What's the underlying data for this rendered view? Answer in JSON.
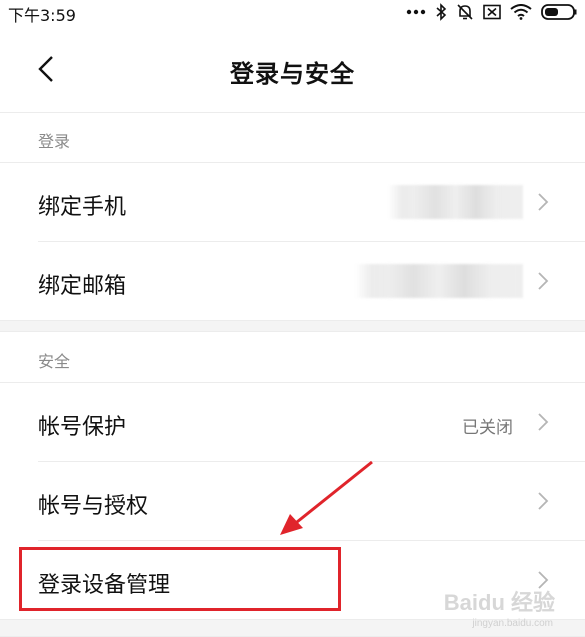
{
  "status_bar": {
    "time": "下午3:59",
    "icons": [
      "more-dots-icon",
      "bluetooth-icon",
      "mute-icon",
      "sim-off-icon",
      "wifi-icon",
      "battery-icon"
    ]
  },
  "header": {
    "title": "登录与安全",
    "back_icon": "back-arrow-icon"
  },
  "sections": [
    {
      "label": "登录",
      "items": [
        {
          "label": "绑定手机",
          "value_hidden": true
        },
        {
          "label": "绑定邮箱",
          "value_hidden": true
        }
      ]
    },
    {
      "label": "安全",
      "items": [
        {
          "label": "帐号保护",
          "value": "已关闭"
        },
        {
          "label": "帐号与授权",
          "value": ""
        },
        {
          "label": "登录设备管理",
          "value": ""
        }
      ]
    }
  ],
  "annotation": {
    "highlight_color": "#e0242b",
    "highlighted_item": "登录设备管理"
  },
  "watermark": {
    "text": "Baidu 经验",
    "sub": "jingyan.baidu.com"
  }
}
